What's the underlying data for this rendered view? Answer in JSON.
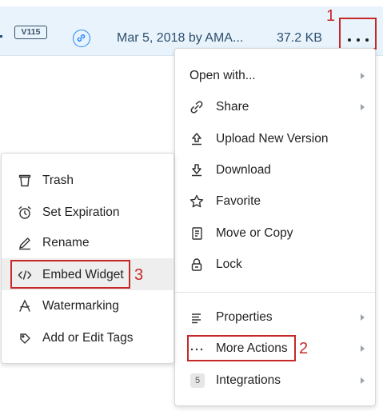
{
  "file_row": {
    "version": "V115",
    "modified": "Mar 5, 2018 by AMA...",
    "size": "37.2 KB"
  },
  "main_menu": {
    "items": [
      {
        "label": "Open with...",
        "icon": "none",
        "submenu": true
      },
      {
        "label": "Share",
        "icon": "link-icon",
        "submenu": true
      },
      {
        "label": "Upload New Version",
        "icon": "upload-icon",
        "submenu": false
      },
      {
        "label": "Download",
        "icon": "download-icon",
        "submenu": false
      },
      {
        "label": "Favorite",
        "icon": "star-icon",
        "submenu": false
      },
      {
        "label": "Move or Copy",
        "icon": "copy-icon",
        "submenu": false
      },
      {
        "label": "Lock",
        "icon": "lock-icon",
        "submenu": false
      }
    ],
    "lower_items": [
      {
        "label": "Properties",
        "icon": "list-icon",
        "submenu": true
      },
      {
        "label": "More Actions",
        "icon": "ellipsis-icon",
        "submenu": true
      },
      {
        "label": "Integrations",
        "icon": "integrations-count",
        "submenu": true
      }
    ],
    "integrations_count": "5"
  },
  "more_actions_menu": {
    "items": [
      {
        "label": "Trash",
        "icon": "trash-icon"
      },
      {
        "label": "Set Expiration",
        "icon": "alarm-clock-icon"
      },
      {
        "label": "Rename",
        "icon": "pencil-icon"
      },
      {
        "label": "Embed Widget",
        "icon": "code-icon",
        "highlighted": true
      },
      {
        "label": "Watermarking",
        "icon": "watermark-icon"
      },
      {
        "label": "Add or Edit Tags",
        "icon": "tag-icon"
      }
    ]
  },
  "callouts": [
    "1",
    "2",
    "3"
  ],
  "colors": {
    "row_background": "#e8f3fb",
    "link_blue": "#2486fc",
    "callout_red": "#c62828",
    "highlight": "#eeeeee"
  }
}
